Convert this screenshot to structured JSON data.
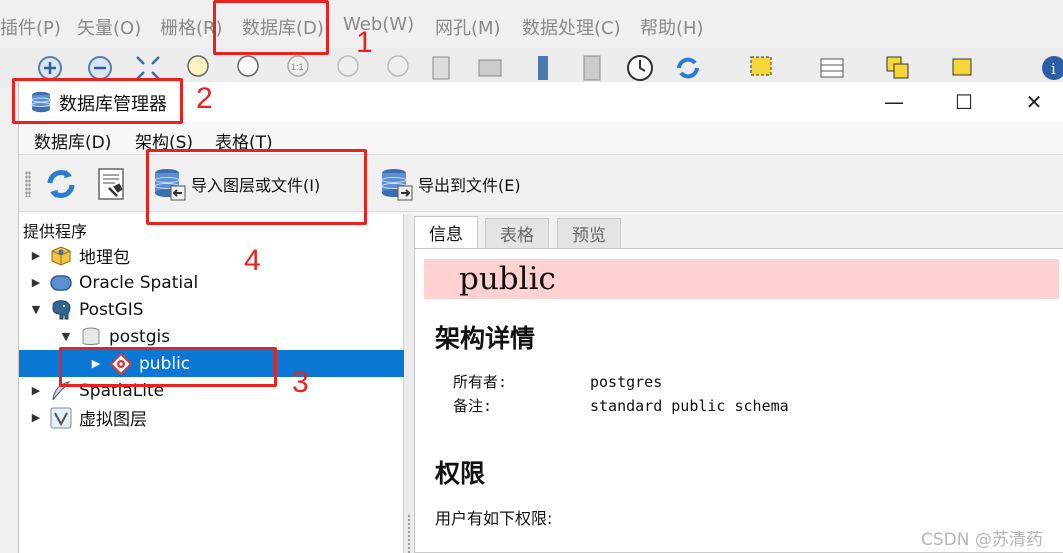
{
  "app": {
    "menu": [
      "插件(P)",
      "矢量(O)",
      "栅格(R)",
      "数据库(D)",
      "Web(W)",
      "网孔(M)",
      "数据处理(C)",
      "帮助(H)"
    ]
  },
  "dialog": {
    "title": "数据库管理器",
    "window_controls": {
      "minimize": "—",
      "maximize": "☐",
      "close": "✕"
    },
    "menu": [
      "数据库(D)",
      "架构(S)",
      "表格(T)"
    ],
    "toolbar": {
      "import_label": "导入图层或文件(I)",
      "export_label": "导出到文件(E)"
    },
    "left_panel": {
      "header": "提供程序",
      "tree": [
        {
          "label": "地理包",
          "icon": "geopackage-icon"
        },
        {
          "label": "Oracle Spatial",
          "icon": "oracle-icon"
        },
        {
          "label": "PostGIS",
          "icon": "postgis-elephant-icon"
        },
        {
          "label": "postgis",
          "icon": "database-icon"
        },
        {
          "label": "public",
          "icon": "schema-icon",
          "selected": true
        },
        {
          "label": "SpatiaLite",
          "icon": "feather-icon"
        },
        {
          "label": "虚拟图层",
          "icon": "virtual-layer-icon"
        }
      ]
    },
    "right_panel": {
      "tabs": [
        "信息",
        "表格",
        "预览"
      ],
      "active_tab": "信息",
      "banner_title": "public",
      "schema_heading": "架构详情",
      "owner_label": "所有者:",
      "owner_value": "postgres",
      "comment_label": "备注:",
      "comment_value": "standard public schema",
      "permissions_heading": "权限",
      "permissions_text": "用户有如下权限:"
    }
  },
  "annotations": [
    "1",
    "2",
    "3",
    "4"
  ],
  "watermark": "CSDN @苏清药",
  "colors": {
    "annotation": "#e8231f",
    "selection": "#0a77d5",
    "banner": "#ffd1d1"
  }
}
